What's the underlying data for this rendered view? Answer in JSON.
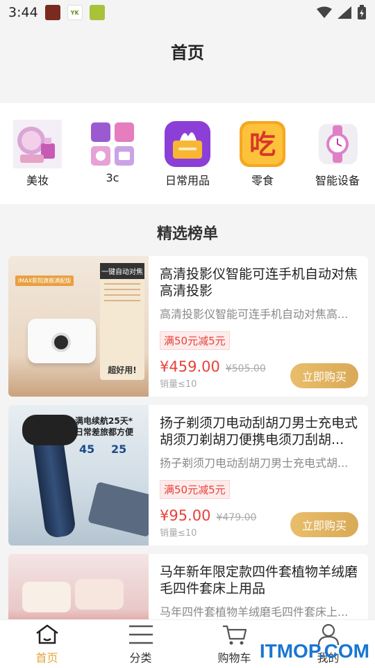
{
  "status_bar": {
    "time": "3:44"
  },
  "header": {
    "title": "首页"
  },
  "categories": [
    {
      "label": "美妆",
      "icon": "makeup-icon"
    },
    {
      "label": "3c",
      "icon": "appliances-icon"
    },
    {
      "label": "日常用品",
      "icon": "tissue-box-icon"
    },
    {
      "label": "零食",
      "icon": "snack-icon"
    },
    {
      "label": "智能设备",
      "icon": "smartwatch-icon"
    }
  ],
  "section": {
    "title": "精选榜单"
  },
  "products": [
    {
      "name": "高清投影仪智能可连手机自动对焦高清投影",
      "desc": "高清投影仪智能可连手机自动对焦高...",
      "promo": "满50元减5元",
      "price": "¥459.00",
      "orig_price": "¥505.00",
      "sales": "销量≤10",
      "buy_label": "立即购买",
      "image_text": {
        "badge": "IMAX影院旗舰满配版",
        "side_title": "一键自动对焦",
        "side_footer": "超好用!"
      }
    },
    {
      "name": "扬子剃须刀电动刮胡刀男士充电式胡须刀剃胡刀便携电须刀刮胡...",
      "desc": "扬子剃须刀电动刮胡刀男士充电式胡...",
      "promo": "满50元减5元",
      "price": "¥95.00",
      "orig_price": "¥479.00",
      "sales": "销量≤10",
      "buy_label": "立即购买",
      "image_text": {
        "line1": "满电续航25天*",
        "line2": "日常差旅都方便",
        "stat1": "45",
        "stat2": "25"
      }
    },
    {
      "name": "马年新年限定款四件套植物羊绒磨毛四件套床上用品",
      "desc": "马年四件套植物羊绒磨毛四件套床上..."
    }
  ],
  "tabs": [
    {
      "label": "首页",
      "icon": "home-icon",
      "active": true
    },
    {
      "label": "分类",
      "icon": "menu-icon",
      "active": false
    },
    {
      "label": "购物车",
      "icon": "cart-icon",
      "active": false
    },
    {
      "label": "我的",
      "icon": "user-icon",
      "active": false
    }
  ],
  "watermark": "ITMOP.COM",
  "colors": {
    "accent": "#e3a43d",
    "price": "#e8413a",
    "button": "#dcae5c"
  }
}
